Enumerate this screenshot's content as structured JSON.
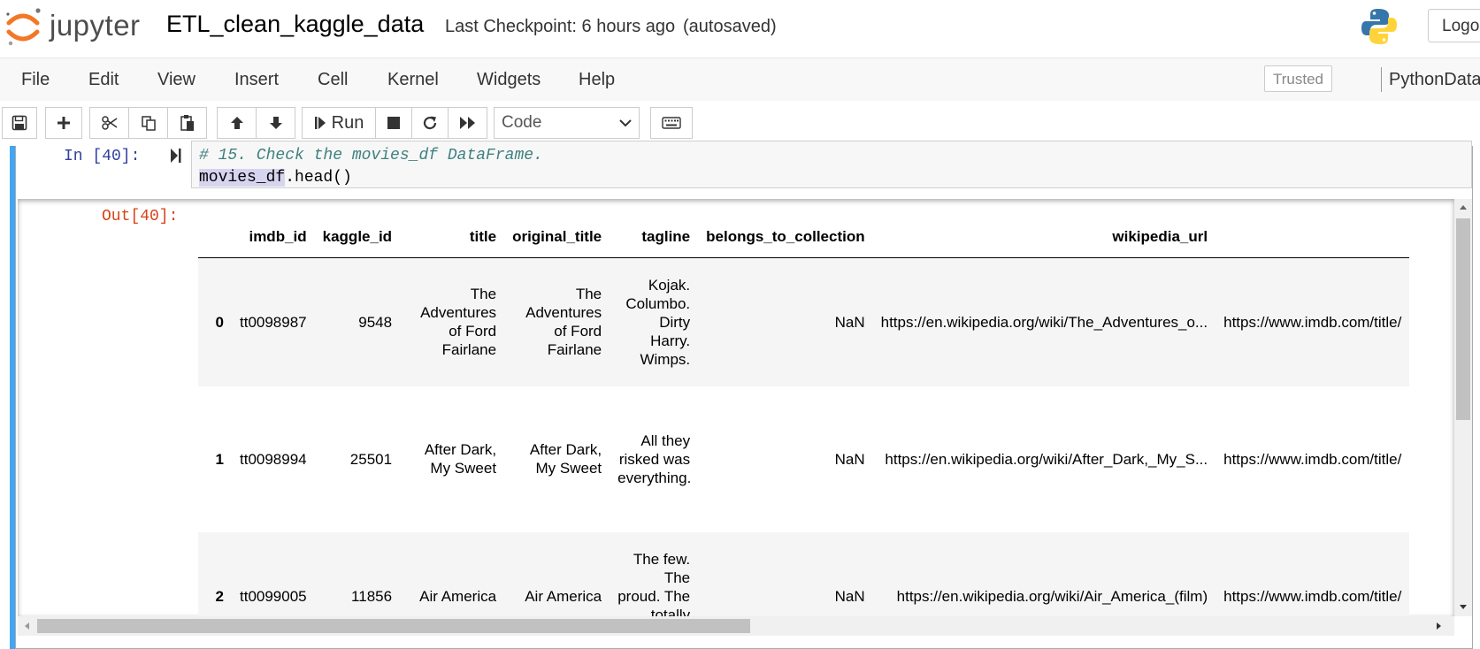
{
  "header": {
    "logo_text": "jupyter",
    "notebook_title": "ETL_clean_kaggle_data",
    "checkpoint": "Last Checkpoint: 6 hours ago",
    "autosave_status": "(autosaved)",
    "logout_label": "Logout"
  },
  "menu": {
    "items": [
      "File",
      "Edit",
      "View",
      "Insert",
      "Cell",
      "Kernel",
      "Widgets",
      "Help"
    ],
    "trusted": "Trusted",
    "kernel_name": "PythonData"
  },
  "toolbar": {
    "run_label": "Run",
    "cell_type": "Code"
  },
  "cell": {
    "in_prompt": "In [40]:",
    "code_comment": "# 15. Check the movies_df DataFrame.",
    "code_highlight": "movies_df",
    "code_rest": ".head()",
    "out_prompt": "Out[40]:"
  },
  "dataframe": {
    "columns": [
      "",
      "imdb_id",
      "kaggle_id",
      "title",
      "original_title",
      "tagline",
      "belongs_to_collection",
      "wikipedia_url",
      ""
    ],
    "rows": [
      {
        "index": "0",
        "imdb_id": "tt0098987",
        "kaggle_id": "9548",
        "title": "The Adventures of Ford Fairlane",
        "original_title": "The Adventures of Ford Fairlane",
        "tagline": "Kojak. Columbo. Dirty Harry. Wimps.",
        "belongs_to_collection": "NaN",
        "wikipedia_url": "https://en.wikipedia.org/wiki/The_Adventures_o...",
        "imdb_link": "https://www.imdb.com/title/"
      },
      {
        "index": "1",
        "imdb_id": "tt0098994",
        "kaggle_id": "25501",
        "title": "After Dark, My Sweet",
        "original_title": "After Dark, My Sweet",
        "tagline": "All they risked was everything.",
        "belongs_to_collection": "NaN",
        "wikipedia_url": "https://en.wikipedia.org/wiki/After_Dark,_My_S...",
        "imdb_link": "https://www.imdb.com/title/"
      },
      {
        "index": "2",
        "imdb_id": "tt0099005",
        "kaggle_id": "11856",
        "title": "Air America",
        "original_title": "Air America",
        "tagline": "The few. The proud. The totally insane.",
        "belongs_to_collection": "NaN",
        "wikipedia_url": "https://en.wikipedia.org/wiki/Air_America_(film)",
        "imdb_link": "https://www.imdb.com/title/"
      }
    ]
  },
  "colors": {
    "accent_cell_bar": "#42a5f5",
    "in_prompt": "#303f9f",
    "out_prompt": "#d84315",
    "comment": "#408080",
    "logo_orange": "#f37726"
  }
}
